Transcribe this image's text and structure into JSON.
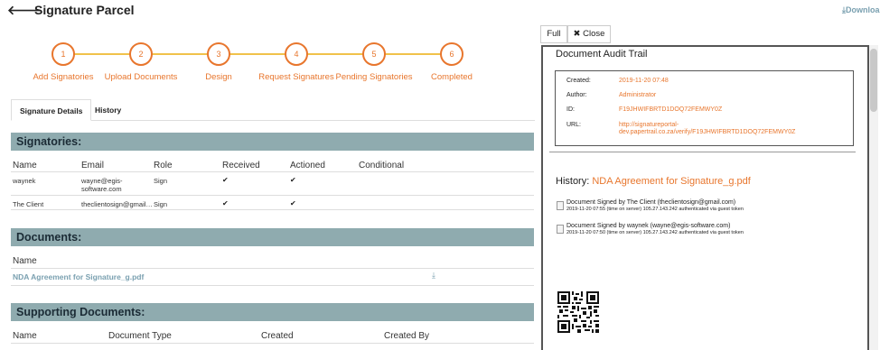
{
  "header": {
    "back_icon": "back-arrow-icon",
    "title": "Signature Parcel",
    "download_label": "Downloa"
  },
  "steps": [
    {
      "number": "1",
      "label": "Add Signatories"
    },
    {
      "number": "2",
      "label": "Upload Documents"
    },
    {
      "number": "3",
      "label": "Design"
    },
    {
      "number": "4",
      "label": "Request Signatures"
    },
    {
      "number": "5",
      "label": "Pending Signatories"
    },
    {
      "number": "6",
      "label": "Completed"
    }
  ],
  "tabs": [
    {
      "label": "Signature Details"
    },
    {
      "label": "History"
    }
  ],
  "signatories": {
    "heading": "Signatories:",
    "columns": [
      "Name",
      "Email",
      "Role",
      "Received",
      "Actioned",
      "Conditional"
    ],
    "rows": [
      {
        "name": "waynek",
        "email_line1": "wayne@egis-",
        "email_line2": "software.com",
        "role": "Sign",
        "received": "✔",
        "actioned": "✔"
      },
      {
        "name": "The Client",
        "email_line1": "theclientosign@gmail…",
        "email_line2": "",
        "role": "Sign",
        "received": "✔",
        "actioned": "✔"
      }
    ]
  },
  "documents": {
    "heading": "Documents:",
    "column": "Name",
    "items": [
      {
        "name": "NDA Agreement for Signature_g.pdf"
      }
    ]
  },
  "supporting": {
    "heading": "Supporting Documents:",
    "columns": [
      "Name",
      "Document Type",
      "Created",
      "Created By"
    ]
  },
  "viewer": {
    "full_label": "Full",
    "close_label": "✖ Close",
    "audit_title": "Document Audit Trail",
    "created_label": "Created:",
    "created_value": "2019-11-20 07:48",
    "author_label": "Author:",
    "author_value": "Administrator",
    "id_label": "ID:",
    "id_value": "F19JHWIFBRTD1DOQ72FEMWY0Z",
    "url_label": "URL:",
    "url_line1": "http://signatureportal-",
    "url_line2": "dev.papertrail.co.za/verify/F19JHWIFBRTD1DOQ72FEMWY0Z",
    "history_label": "History:",
    "history_doc": "NDA Agreement for Signature_g.pdf",
    "history": [
      {
        "main": "Document Signed by The Client (theclientosign@gmail.com)",
        "sub": "2019-11-20 07:55 (time on server) 105.27.143.242 authenticated via guest token"
      },
      {
        "main": "Document Signed by waynek (wayne@egis-software.com)",
        "sub": "2019-11-20 07:50 (time on server) 105.27.143.242 authenticated via guest token"
      }
    ]
  },
  "colors": {
    "accent_orange": "#e8762d",
    "step_line": "#f0c24a",
    "section_bg": "#8fabaf",
    "link": "#7aa0b0"
  }
}
